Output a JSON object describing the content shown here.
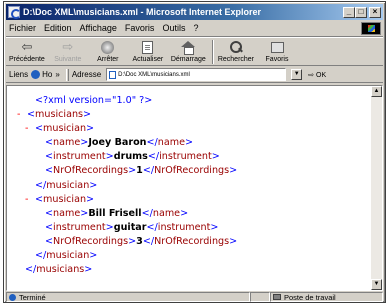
{
  "window": {
    "title": "D:\\Doc XML\\musicians.xml - Microsoft Internet Explorer",
    "caption_buttons": [
      "_",
      "□",
      "×"
    ]
  },
  "menu": {
    "items": [
      "Fichier",
      "Edition",
      "Affichage",
      "Favoris",
      "Outils",
      "?"
    ]
  },
  "toolbar": {
    "back": "Précédente",
    "forward": "Suivante",
    "stop": "Arrêter",
    "refresh": "Actualiser",
    "home": "Démarrage",
    "search": "Rechercher",
    "favorites": "Favoris"
  },
  "addressbar": {
    "links_label": "Liens",
    "links_item": "Ho",
    "chevron": "»",
    "address_label": "Adresse",
    "url": "D:\\Doc XML\\musicians.xml",
    "go_label": "OK"
  },
  "xml": {
    "declaration": "<?xml version=\"1.0\" ?>",
    "collapse_marker": "-",
    "root_tag": "musicians",
    "item_tag": "musician",
    "musicians": [
      {
        "name": "Joey Baron",
        "instrument": "drums",
        "recordings": "1"
      },
      {
        "name": "Bill Frisell",
        "instrument": "guitar",
        "recordings": "3"
      }
    ],
    "fields": {
      "name": "name",
      "instrument": "instrument",
      "recordings": "NrOfRecordings"
    }
  },
  "status": {
    "text": "Terminé",
    "zone": "Poste de travail"
  }
}
